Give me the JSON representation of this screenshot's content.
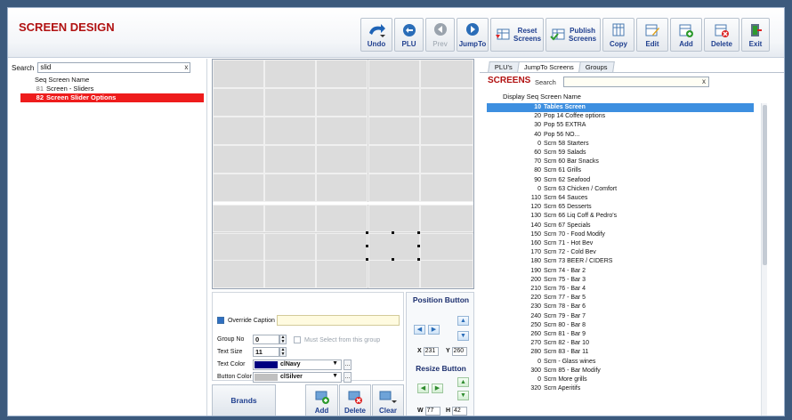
{
  "header": {
    "title": "SCREEN DESIGN"
  },
  "toolbar": {
    "undo": "Undo",
    "plu": "PLU",
    "prev": "Prev",
    "jumpto": "JumpTo",
    "reset_line1": "Reset",
    "reset_line2": "Screens",
    "publish_line1": "Publish",
    "publish_line2": "Screens",
    "copy": "Copy",
    "edit": "Edit",
    "add": "Add",
    "delete": "Delete",
    "exit": "Exit"
  },
  "left_panel": {
    "search_label": "Search",
    "search_value": "slid",
    "clear_label": "x",
    "list_header": "Seq Screen Name",
    "rows": [
      {
        "seq": "81",
        "name": "Screen - Sliders",
        "selected": false
      },
      {
        "seq": "82",
        "name": "Screen Slider Options",
        "selected": true
      }
    ]
  },
  "props": {
    "override_caption_label": "Override Caption",
    "override_caption_checked": true,
    "group_no_label": "Group No",
    "group_no_value": "0",
    "must_select_label": "Must Select from this group",
    "must_select_checked": false,
    "text_size_label": "Text Size",
    "text_size_value": "11",
    "text_color_label": "Text Color",
    "text_color_name": "clNavy",
    "text_color_hex": "#000080",
    "button_color_label": "Button Color",
    "button_color_name": "clSilver",
    "button_color_hex": "#c0c0c0",
    "ellipsis": "..."
  },
  "position": {
    "title": "Position Button",
    "x_label": "X",
    "x_value": "231",
    "y_label": "Y",
    "y_value": "260"
  },
  "resize": {
    "title": "Resize Button",
    "w_label": "W",
    "w_value": "77",
    "h_label": "H",
    "h_value": "42"
  },
  "bottom": {
    "brands": "Brands",
    "add": "Add",
    "delete": "Delete",
    "clear": "Clear"
  },
  "right_panel": {
    "tabs": [
      "PLU's",
      "JumpTo Screens",
      "Groups"
    ],
    "active_tab": 1,
    "title": "SCREENS",
    "search_label": "Search",
    "search_value": "",
    "clear_label": "x",
    "col_header": "Display Seq Screen Name",
    "rows": [
      {
        "seq": "10",
        "name": "Tables Screen",
        "selected": true
      },
      {
        "seq": "20",
        "name": "Pop 14 Coffee options",
        "selected": false
      },
      {
        "seq": "30",
        "name": "Pop 55 EXTRA",
        "selected": false
      },
      {
        "seq": "40",
        "name": "Pop 56 NO...",
        "selected": false
      },
      {
        "seq": "0",
        "name": "Scrn 58 Starters",
        "selected": false
      },
      {
        "seq": "60",
        "name": "Scrn 59 Salads",
        "selected": false
      },
      {
        "seq": "70",
        "name": "Scrn 60 Bar Snacks",
        "selected": false
      },
      {
        "seq": "80",
        "name": "Scrn 61 Grills",
        "selected": false
      },
      {
        "seq": "90",
        "name": "Scrn 62 Seafood",
        "selected": false
      },
      {
        "seq": "0",
        "name": "Scrn 63 Chicken / Comfort",
        "selected": false
      },
      {
        "seq": "110",
        "name": "Scrn 64 Sauces",
        "selected": false
      },
      {
        "seq": "120",
        "name": "Scrn 65 Desserts",
        "selected": false
      },
      {
        "seq": "130",
        "name": "Scrn 66 Liq Coff & Pedro's",
        "selected": false
      },
      {
        "seq": "140",
        "name": "Scrn 67 Specials",
        "selected": false
      },
      {
        "seq": "150",
        "name": "Scrn 70 - Food Modify",
        "selected": false
      },
      {
        "seq": "160",
        "name": "Scrn 71 - Hot Bev",
        "selected": false
      },
      {
        "seq": "170",
        "name": "Scrn 72 - Cold Bev",
        "selected": false
      },
      {
        "seq": "180",
        "name": "Scrn 73 BEER / CIDERS",
        "selected": false
      },
      {
        "seq": "190",
        "name": "Scrn 74 - Bar 2",
        "selected": false
      },
      {
        "seq": "200",
        "name": "Scrn 75 - Bar 3",
        "selected": false
      },
      {
        "seq": "210",
        "name": "Scrn 76 - Bar 4",
        "selected": false
      },
      {
        "seq": "220",
        "name": "Scrn 77 - Bar 5",
        "selected": false
      },
      {
        "seq": "230",
        "name": "Scrn 78 - Bar 6",
        "selected": false
      },
      {
        "seq": "240",
        "name": "Scrn 79 - Bar 7",
        "selected": false
      },
      {
        "seq": "250",
        "name": "Scrn 80 - Bar 8",
        "selected": false
      },
      {
        "seq": "260",
        "name": "Scrn 81 - Bar 9",
        "selected": false
      },
      {
        "seq": "270",
        "name": "Scrn 82 - Bar 10",
        "selected": false
      },
      {
        "seq": "280",
        "name": "Scrn 83 - Bar 11",
        "selected": false
      },
      {
        "seq": "0",
        "name": "Scrn - Glass wines",
        "selected": false
      },
      {
        "seq": "300",
        "name": "Scrn 85 - Bar Modify",
        "selected": false
      },
      {
        "seq": "0",
        "name": "Scrn More grills",
        "selected": false
      },
      {
        "seq": "320",
        "name": "Scrn Aperitifs",
        "selected": false
      }
    ]
  },
  "colors": {
    "title_red": "#b11111",
    "selection_red": "#ee1c1c",
    "selection_blue": "#3d8fe0",
    "toolbar_text": "#1f3f8f"
  }
}
